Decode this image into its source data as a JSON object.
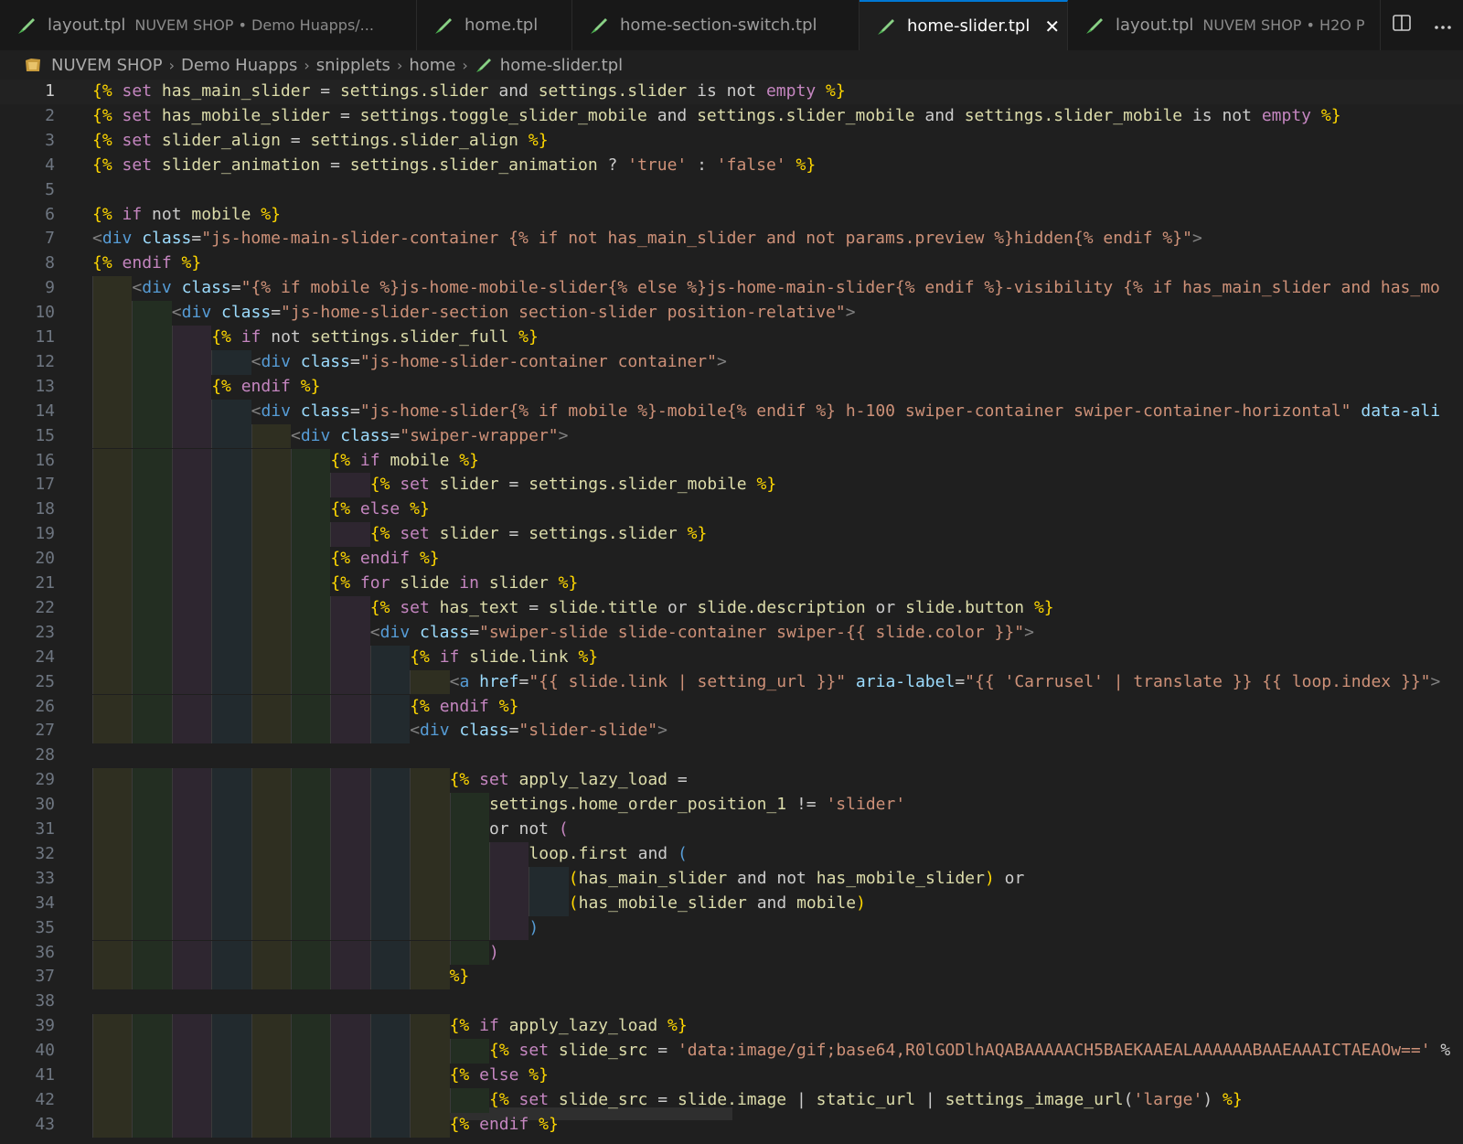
{
  "tabs": [
    {
      "name": "layout.tpl",
      "desc": "NUVEM SHOP • Demo Huapps/...",
      "active": false
    },
    {
      "name": "home.tpl",
      "desc": "",
      "active": false
    },
    {
      "name": "home-section-switch.tpl",
      "desc": "",
      "active": false
    },
    {
      "name": "home-slider.tpl",
      "desc": "",
      "active": true
    },
    {
      "name": "layout.tpl",
      "desc": "NUVEM SHOP • H2O P",
      "active": false
    }
  ],
  "tab_actions": {
    "split_icon": "split-editor-icon",
    "more_icon": "more-actions-icon"
  },
  "breadcrumb": [
    "NUVEM SHOP",
    "Demo Huapps",
    "snipplets",
    "home",
    "home-slider.tpl"
  ],
  "colors": {
    "delimiter": "#ffd700",
    "keyword": "#c586c0",
    "variable": "#dcdcaa",
    "plain": "#cccccc",
    "string": "#ce9178",
    "tag": "#569cd6",
    "attr": "#9cdcfe",
    "active_tab_border": "#0078d4",
    "editor_bg": "#1f1f1f"
  },
  "lines": [
    {
      "n": "1",
      "indent": 0,
      "tokens": [
        [
          "b",
          "{%"
        ],
        [
          "k",
          " set "
        ],
        [
          "v",
          "has_main_slider"
        ],
        [
          "p",
          " = "
        ],
        [
          "v",
          "settings.slider"
        ],
        [
          "p",
          " and "
        ],
        [
          "v",
          "settings.slider"
        ],
        [
          "p",
          " is not "
        ],
        [
          "k",
          "empty"
        ],
        [
          "b",
          " %}"
        ]
      ]
    },
    {
      "n": "2",
      "indent": 0,
      "tokens": [
        [
          "b",
          "{%"
        ],
        [
          "k",
          " set "
        ],
        [
          "v",
          "has_mobile_slider"
        ],
        [
          "p",
          " = "
        ],
        [
          "v",
          "settings.toggle_slider_mobile"
        ],
        [
          "p",
          " and "
        ],
        [
          "v",
          "settings.slider_mobile"
        ],
        [
          "p",
          " and "
        ],
        [
          "v",
          "settings.slider_mobile"
        ],
        [
          "p",
          " is not "
        ],
        [
          "k",
          "empty"
        ],
        [
          "b",
          " %}"
        ]
      ]
    },
    {
      "n": "3",
      "indent": 0,
      "tokens": [
        [
          "b",
          "{%"
        ],
        [
          "k",
          " set "
        ],
        [
          "v",
          "slider_align"
        ],
        [
          "p",
          " = "
        ],
        [
          "v",
          "settings.slider_align"
        ],
        [
          "b",
          " %}"
        ]
      ]
    },
    {
      "n": "4",
      "indent": 0,
      "tokens": [
        [
          "b",
          "{%"
        ],
        [
          "k",
          " set "
        ],
        [
          "v",
          "slider_animation"
        ],
        [
          "p",
          " = "
        ],
        [
          "v",
          "settings.slider_animation"
        ],
        [
          "p",
          " ? "
        ],
        [
          "s",
          "'true'"
        ],
        [
          "p",
          " : "
        ],
        [
          "s",
          "'false'"
        ],
        [
          "b",
          " %}"
        ]
      ]
    },
    {
      "n": "5",
      "indent": 0,
      "tokens": []
    },
    {
      "n": "6",
      "indent": 0,
      "tokens": [
        [
          "b",
          "{%"
        ],
        [
          "k",
          " if "
        ],
        [
          "p",
          "not "
        ],
        [
          "v",
          "mobile"
        ],
        [
          "b",
          " %}"
        ]
      ]
    },
    {
      "n": "7",
      "indent": 0,
      "tokens": [
        [
          "g",
          "<"
        ],
        [
          "t",
          "div"
        ],
        [
          "a",
          " class"
        ],
        [
          "p",
          "="
        ],
        [
          "s",
          "\"js-home-main-slider-container {% if not has_main_slider and not params.preview %}hidden{% endif %}\""
        ],
        [
          "g",
          ">"
        ]
      ]
    },
    {
      "n": "8",
      "indent": 0,
      "tokens": [
        [
          "b",
          "{%"
        ],
        [
          "k",
          " endif"
        ],
        [
          "b",
          " %}"
        ]
      ]
    },
    {
      "n": "9",
      "indent": 1,
      "tokens": [
        [
          "g",
          "<"
        ],
        [
          "t",
          "div"
        ],
        [
          "a",
          " class"
        ],
        [
          "p",
          "="
        ],
        [
          "s",
          "\"{% if mobile %}js-home-mobile-slider{% else %}js-home-main-slider{% endif %}-visibility {% if has_main_slider and has_mo"
        ]
      ]
    },
    {
      "n": "10",
      "indent": 2,
      "tokens": [
        [
          "g",
          "<"
        ],
        [
          "t",
          "div"
        ],
        [
          "a",
          " class"
        ],
        [
          "p",
          "="
        ],
        [
          "s",
          "\"js-home-slider-section section-slider position-relative\""
        ],
        [
          "g",
          ">"
        ]
      ]
    },
    {
      "n": "11",
      "indent": 3,
      "tokens": [
        [
          "b",
          "{%"
        ],
        [
          "k",
          " if "
        ],
        [
          "p",
          "not "
        ],
        [
          "v",
          "settings.slider_full"
        ],
        [
          "b",
          " %}"
        ]
      ]
    },
    {
      "n": "12",
      "indent": 4,
      "tokens": [
        [
          "g",
          "<"
        ],
        [
          "t",
          "div"
        ],
        [
          "a",
          " class"
        ],
        [
          "p",
          "="
        ],
        [
          "s",
          "\"js-home-slider-container container\""
        ],
        [
          "g",
          ">"
        ]
      ]
    },
    {
      "n": "13",
      "indent": 3,
      "tokens": [
        [
          "b",
          "{%"
        ],
        [
          "k",
          " endif"
        ],
        [
          "b",
          " %}"
        ]
      ]
    },
    {
      "n": "14",
      "indent": 4,
      "tokens": [
        [
          "g",
          "<"
        ],
        [
          "t",
          "div"
        ],
        [
          "a",
          " class"
        ],
        [
          "p",
          "="
        ],
        [
          "s",
          "\"js-home-slider{% if mobile %}-mobile{% endif %} h-100 swiper-container swiper-container-horizontal\""
        ],
        [
          "a",
          " data-ali"
        ]
      ]
    },
    {
      "n": "15",
      "indent": 5,
      "tokens": [
        [
          "g",
          "<"
        ],
        [
          "t",
          "div"
        ],
        [
          "a",
          " class"
        ],
        [
          "p",
          "="
        ],
        [
          "s",
          "\"swiper-wrapper\""
        ],
        [
          "g",
          ">"
        ]
      ]
    },
    {
      "n": "16",
      "indent": 6,
      "tokens": [
        [
          "b",
          "{%"
        ],
        [
          "k",
          " if "
        ],
        [
          "v",
          "mobile"
        ],
        [
          "b",
          " %}"
        ]
      ]
    },
    {
      "n": "17",
      "indent": 7,
      "tokens": [
        [
          "b",
          "{%"
        ],
        [
          "k",
          " set "
        ],
        [
          "v",
          "slider"
        ],
        [
          "p",
          " = "
        ],
        [
          "v",
          "settings.slider_mobile"
        ],
        [
          "b",
          " %}"
        ]
      ]
    },
    {
      "n": "18",
      "indent": 6,
      "tokens": [
        [
          "b",
          "{%"
        ],
        [
          "k",
          " else"
        ],
        [
          "b",
          " %}"
        ]
      ]
    },
    {
      "n": "19",
      "indent": 7,
      "tokens": [
        [
          "b",
          "{%"
        ],
        [
          "k",
          " set "
        ],
        [
          "v",
          "slider"
        ],
        [
          "p",
          " = "
        ],
        [
          "v",
          "settings.slider"
        ],
        [
          "b",
          " %}"
        ]
      ]
    },
    {
      "n": "20",
      "indent": 6,
      "tokens": [
        [
          "b",
          "{%"
        ],
        [
          "k",
          " endif"
        ],
        [
          "b",
          " %}"
        ]
      ]
    },
    {
      "n": "21",
      "indent": 6,
      "tokens": [
        [
          "b",
          "{%"
        ],
        [
          "k",
          " for "
        ],
        [
          "v",
          "slide"
        ],
        [
          "k",
          " in "
        ],
        [
          "v",
          "slider"
        ],
        [
          "b",
          " %}"
        ]
      ]
    },
    {
      "n": "22",
      "indent": 7,
      "tokens": [
        [
          "b",
          "{%"
        ],
        [
          "k",
          " set "
        ],
        [
          "v",
          "has_text"
        ],
        [
          "p",
          " = "
        ],
        [
          "v",
          "slide.title"
        ],
        [
          "p",
          " or "
        ],
        [
          "v",
          "slide.description"
        ],
        [
          "p",
          " or "
        ],
        [
          "v",
          "slide.button"
        ],
        [
          "b",
          " %}"
        ]
      ]
    },
    {
      "n": "23",
      "indent": 7,
      "tokens": [
        [
          "g",
          "<"
        ],
        [
          "t",
          "div"
        ],
        [
          "a",
          " class"
        ],
        [
          "p",
          "="
        ],
        [
          "s",
          "\"swiper-slide slide-container swiper-{{ slide.color }}\""
        ],
        [
          "g",
          ">"
        ]
      ]
    },
    {
      "n": "24",
      "indent": 8,
      "tokens": [
        [
          "b",
          "{%"
        ],
        [
          "k",
          " if "
        ],
        [
          "v",
          "slide.link"
        ],
        [
          "b",
          " %}"
        ]
      ]
    },
    {
      "n": "25",
      "indent": 9,
      "tokens": [
        [
          "g",
          "<"
        ],
        [
          "t",
          "a"
        ],
        [
          "a",
          " href"
        ],
        [
          "p",
          "="
        ],
        [
          "s",
          "\"{{ slide.link | setting_url }}\""
        ],
        [
          "a",
          " aria-label"
        ],
        [
          "p",
          "="
        ],
        [
          "s",
          "\"{{ 'Carrusel' | translate }} {{ loop.index }}\""
        ],
        [
          "g",
          ">"
        ]
      ]
    },
    {
      "n": "26",
      "indent": 8,
      "tokens": [
        [
          "b",
          "{%"
        ],
        [
          "k",
          " endif"
        ],
        [
          "b",
          " %}"
        ]
      ]
    },
    {
      "n": "27",
      "indent": 8,
      "tokens": [
        [
          "g",
          "<"
        ],
        [
          "t",
          "div"
        ],
        [
          "a",
          " class"
        ],
        [
          "p",
          "="
        ],
        [
          "s",
          "\"slider-slide\""
        ],
        [
          "g",
          ">"
        ]
      ]
    },
    {
      "n": "28",
      "indent": 0,
      "tokens": []
    },
    {
      "n": "29",
      "indent": 9,
      "tokens": [
        [
          "b",
          "{%"
        ],
        [
          "k",
          " set "
        ],
        [
          "v",
          "apply_lazy_load"
        ],
        [
          "p",
          " ="
        ]
      ]
    },
    {
      "n": "30",
      "indent": 10,
      "tokens": [
        [
          "v",
          "settings.home_order_position_1"
        ],
        [
          "p",
          " != "
        ],
        [
          "s",
          "'slider'"
        ]
      ]
    },
    {
      "n": "31",
      "indent": 10,
      "tokens": [
        [
          "p",
          "or not "
        ],
        [
          "k",
          "("
        ]
      ]
    },
    {
      "n": "32",
      "indent": 11,
      "tokens": [
        [
          "v",
          "loop.first"
        ],
        [
          "p",
          " and "
        ],
        [
          "t",
          "("
        ]
      ]
    },
    {
      "n": "33",
      "indent": 12,
      "tokens": [
        [
          "b",
          "("
        ],
        [
          "v",
          "has_main_slider"
        ],
        [
          "p",
          " and not "
        ],
        [
          "v",
          "has_mobile_slider"
        ],
        [
          "b",
          ")"
        ],
        [
          "p",
          " or"
        ]
      ]
    },
    {
      "n": "34",
      "indent": 12,
      "tokens": [
        [
          "b",
          "("
        ],
        [
          "v",
          "has_mobile_slider"
        ],
        [
          "p",
          " and "
        ],
        [
          "v",
          "mobile"
        ],
        [
          "b",
          ")"
        ]
      ]
    },
    {
      "n": "35",
      "indent": 11,
      "tokens": [
        [
          "t",
          ")"
        ]
      ]
    },
    {
      "n": "36",
      "indent": 10,
      "tokens": [
        [
          "k",
          ")"
        ]
      ]
    },
    {
      "n": "37",
      "indent": 9,
      "tokens": [
        [
          "b",
          "%}"
        ]
      ]
    },
    {
      "n": "38",
      "indent": 0,
      "tokens": []
    },
    {
      "n": "39",
      "indent": 9,
      "tokens": [
        [
          "b",
          "{%"
        ],
        [
          "k",
          " if "
        ],
        [
          "v",
          "apply_lazy_load"
        ],
        [
          "b",
          " %}"
        ]
      ]
    },
    {
      "n": "40",
      "indent": 10,
      "tokens": [
        [
          "b",
          "{%"
        ],
        [
          "k",
          " set "
        ],
        [
          "v",
          "slide_src"
        ],
        [
          "p",
          " = "
        ],
        [
          "s",
          "'data:image/gif;base64,R0lGODlhAQABAAAAACH5BAEKAAEALAAAAAABAAEAAAICTAEAOw=='"
        ],
        [
          "p",
          " %"
        ]
      ]
    },
    {
      "n": "41",
      "indent": 9,
      "tokens": [
        [
          "b",
          "{%"
        ],
        [
          "k",
          " else"
        ],
        [
          "b",
          " %}"
        ]
      ]
    },
    {
      "n": "42",
      "indent": 10,
      "tokens": [
        [
          "b",
          "{%"
        ],
        [
          "k",
          " set "
        ],
        [
          "v",
          "slide_src"
        ],
        [
          "p",
          " = "
        ],
        [
          "v",
          "slide.image"
        ],
        [
          "p",
          " | "
        ],
        [
          "v",
          "static_url"
        ],
        [
          "p",
          " | "
        ],
        [
          "v",
          "settings_image_url"
        ],
        [
          "p",
          "("
        ],
        [
          "s",
          "'large'"
        ],
        [
          "p",
          ")"
        ],
        [
          "b",
          " %}"
        ]
      ]
    },
    {
      "n": "43",
      "indent": 9,
      "tokens": [
        [
          "b",
          "{%"
        ],
        [
          "k",
          " endif"
        ],
        [
          "b",
          " %}"
        ]
      ]
    }
  ]
}
